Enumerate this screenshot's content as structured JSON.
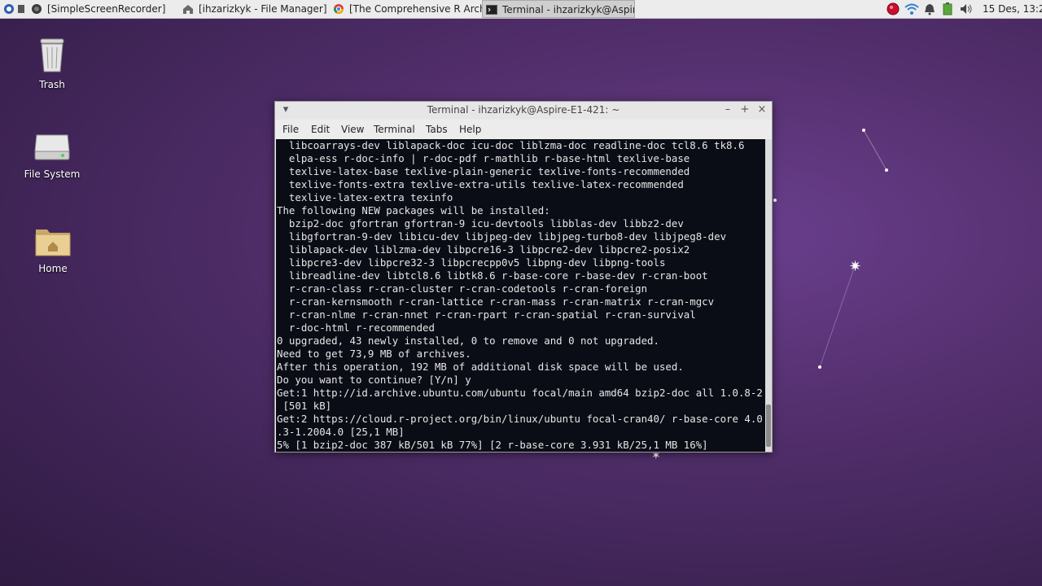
{
  "panel": {
    "tasks": [
      {
        "label": "[SimpleScreenRecorder]",
        "icon": "screen-recorder-icon"
      },
      {
        "label": "[ihzarizkyk - File Manager]",
        "icon": "home-folder-icon"
      },
      {
        "label": "[The Comprehensive R Archi...",
        "icon": "chrome-icon"
      },
      {
        "label": "Terminal - ihzarizkyk@Aspir...",
        "icon": "terminal-icon"
      }
    ],
    "clock": "15 Des, 13:2"
  },
  "desktop": {
    "icons": [
      {
        "label": "Trash",
        "icon": "trash-icon"
      },
      {
        "label": "File System",
        "icon": "drive-icon"
      },
      {
        "label": "Home",
        "icon": "home-folder-icon"
      }
    ]
  },
  "window": {
    "title": "Terminal - ihzarizkyk@Aspire-E1-421: ~",
    "menu": [
      "File",
      "Edit",
      "View",
      "Terminal",
      "Tabs",
      "Help"
    ]
  },
  "terminal": {
    "lines": [
      "  libcoarrays-dev liblapack-doc icu-doc liblzma-doc readline-doc tcl8.6 tk8.6",
      "  elpa-ess r-doc-info | r-doc-pdf r-mathlib r-base-html texlive-base",
      "  texlive-latex-base texlive-plain-generic texlive-fonts-recommended",
      "  texlive-fonts-extra texlive-extra-utils texlive-latex-recommended",
      "  texlive-latex-extra texinfo",
      "The following NEW packages will be installed:",
      "  bzip2-doc gfortran gfortran-9 icu-devtools libblas-dev libbz2-dev",
      "  libgfortran-9-dev libicu-dev libjpeg-dev libjpeg-turbo8-dev libjpeg8-dev",
      "  liblapack-dev liblzma-dev libpcre16-3 libpcre2-dev libpcre2-posix2",
      "  libpcre3-dev libpcre32-3 libpcrecpp0v5 libpng-dev libpng-tools",
      "  libreadline-dev libtcl8.6 libtk8.6 r-base-core r-base-dev r-cran-boot",
      "  r-cran-class r-cran-cluster r-cran-codetools r-cran-foreign",
      "  r-cran-kernsmooth r-cran-lattice r-cran-mass r-cran-matrix r-cran-mgcv",
      "  r-cran-nlme r-cran-nnet r-cran-rpart r-cran-spatial r-cran-survival",
      "  r-doc-html r-recommended",
      "0 upgraded, 43 newly installed, 0 to remove and 0 not upgraded.",
      "Need to get 73,9 MB of archives.",
      "After this operation, 192 MB of additional disk space will be used.",
      "Do you want to continue? [Y/n] y",
      "Get:1 http://id.archive.ubuntu.com/ubuntu focal/main amd64 bzip2-doc all 1.0.8-2",
      " [501 kB]",
      "Get:2 https://cloud.r-project.org/bin/linux/ubuntu focal-cran40/ r-base-core 4.0",
      ".3-1.2004.0 [25,1 MB]",
      "5% [1 bzip2-doc 387 kB/501 kB 77%] [2 r-base-core 3.931 kB/25,1 MB 16%]"
    ]
  }
}
